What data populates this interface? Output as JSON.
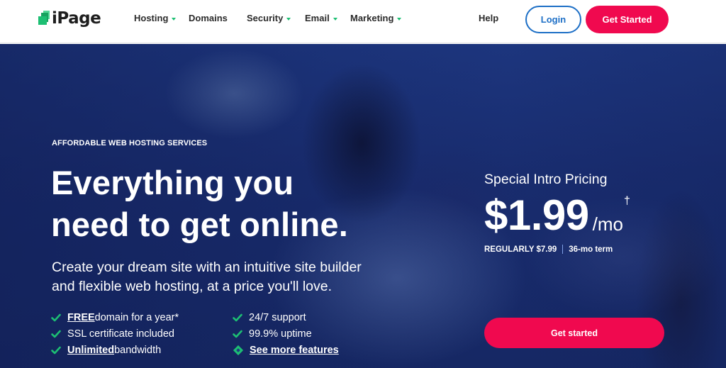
{
  "header": {
    "logo_text": "iPage",
    "nav": [
      {
        "label": "Hosting",
        "has_dropdown": true
      },
      {
        "label": "Domains",
        "has_dropdown": false
      },
      {
        "label": "Security",
        "has_dropdown": true
      },
      {
        "label": "Email",
        "has_dropdown": true
      },
      {
        "label": "Marketing",
        "has_dropdown": true
      },
      {
        "label": "Help",
        "has_dropdown": false
      }
    ],
    "login_label": "Login",
    "get_started_label": "Get Started"
  },
  "hero": {
    "eyebrow": "AFFORDABLE WEB HOSTING SERVICES",
    "headline_line1": "Everything you",
    "headline_line2": "need to get online.",
    "subhead_line1": "Create your dream site with an intuitive site builder",
    "subhead_line2": "and flexible web hosting, at a price you'll love.",
    "features": [
      {
        "strong": "FREE",
        "text": " domain for a year*"
      },
      {
        "strong": "",
        "text": "SSL certificate included"
      },
      {
        "strong": "Unlimited",
        "text": " bandwidth"
      },
      {
        "strong": "",
        "text": "24/7 support"
      },
      {
        "strong": "",
        "text": "99.9% uptime"
      }
    ],
    "see_more_label": "See more features"
  },
  "pricing": {
    "label": "Special Intro Pricing",
    "price": "$1.99",
    "period": "/mo",
    "footnote_mark": "†",
    "regular": "REGULARLY $7.99",
    "term": "36-mo term",
    "cta_label": "Get started"
  },
  "colors": {
    "accent_pink": "#f0094f",
    "login_blue": "#1d6fc6",
    "check_green": "#1dbf73",
    "hero_blue": "#1f3a86"
  },
  "icons": {
    "logo": "ipage-logo-icon",
    "dropdown": "chevron-down-icon",
    "feature": "check-icon",
    "see_more": "diamond-icon"
  }
}
